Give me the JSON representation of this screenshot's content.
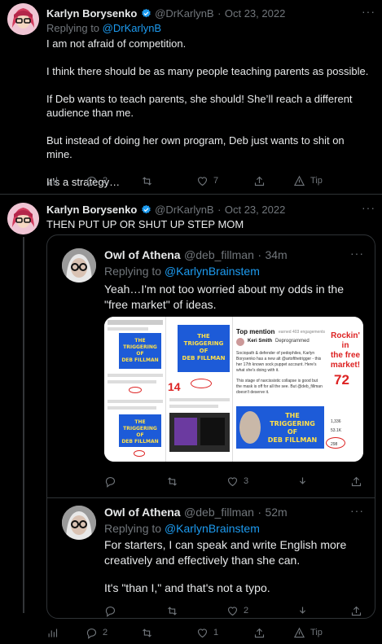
{
  "tweet1": {
    "name": "Karlyn Borysenko",
    "handle": "@DrKarlynB",
    "sep": "·",
    "date": "Oct 23, 2022",
    "replying_prefix": "Replying to",
    "replying_handle": "@DrKarlynB",
    "lines": [
      "I am not afraid of competition.",
      "I think there should be as many people teaching parents as possible.",
      "If Deb wants to teach parents, she should! She’ll reach a different audience than me.",
      "But instead of doing her own program, Deb just wants to shit on mine.",
      "It’s a strategy…"
    ],
    "replies": "2",
    "likes": "7",
    "tip": "Tip"
  },
  "tweet2": {
    "name": "Karlyn Borysenko",
    "handle": "@DrKarlynB",
    "sep": "·",
    "date": "Oct 23, 2022",
    "text": "THEN PUT UP OR SHUT UP STEP MOM",
    "replies": "2",
    "likes": "1",
    "tip": "Tip"
  },
  "quote1": {
    "name": "Owl of Athena",
    "handle": "@deb_fillman",
    "sep": "·",
    "time": "34m",
    "replying_prefix": "Replying to",
    "replying_handle": "@KarlynBrainstem",
    "text": "Yeah…I'm not too worried about my odds in the \"free market\" of ideas.",
    "likes": "3",
    "collage": {
      "poster_lines": [
        "THE",
        "TRIGGERING",
        "OF",
        "DEB FILLMAN"
      ],
      "top_mention": "Top mention",
      "top_mention_sub": "earned 403 engagements",
      "mention_name": "Keri Smith",
      "mention_tag": "Deprogrammed",
      "mention_text": "Sociopath & defender of pedophiles, Karlyn Borysenko has a new alt @artofthetrigger - this her 17th known sock puppet account. Here's what she's doing with it.",
      "mention_text2": "This stage of narcissistic collapse is good but the mask is off for all the see. But @deb_fillman doesn't deserve it.",
      "rockin": [
        "Rockin' in",
        "the free",
        "market!"
      ],
      "big_72": "72",
      "big_14": "14",
      "stat1": "1,336",
      "stat2": "53.1K",
      "stat3": "298"
    }
  },
  "quote2": {
    "name": "Owl of Athena",
    "handle": "@deb_fillman",
    "sep": "·",
    "time": "52m",
    "replying_prefix": "Replying to",
    "replying_handle": "@KarlynBrainstem",
    "text1": "For starters, I can speak and write English more creatively and effectively than she can.",
    "text2": "It's \"than I,\" and that's not a typo.",
    "likes": "2"
  },
  "menu_glyph": "···"
}
